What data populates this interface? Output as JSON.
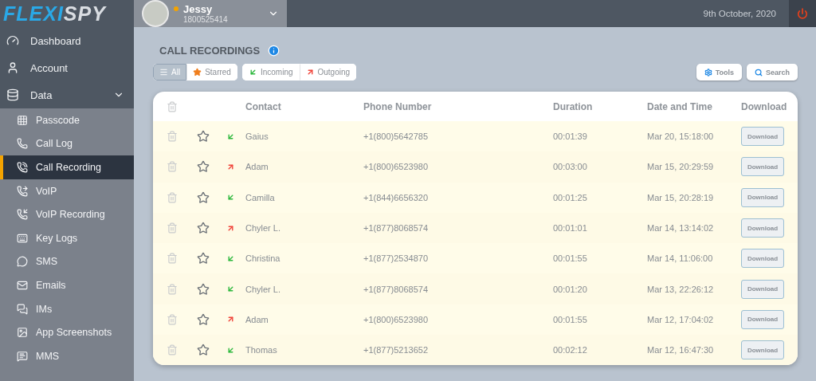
{
  "logo": {
    "part_1": "FLEXI",
    "part_2": "SPY"
  },
  "user": {
    "name": "Jessy",
    "phone": "1800525414"
  },
  "header": {
    "date": "9th October, 2020"
  },
  "sidebar": {
    "items": [
      {
        "label": "Dashboard",
        "selected": false
      },
      {
        "label": "Account",
        "selected": false
      },
      {
        "label": "Data",
        "selected": false,
        "expanded": true,
        "children": [
          {
            "label": "Passcode",
            "selected": false
          },
          {
            "label": "Call Log",
            "selected": false
          },
          {
            "label": "Call Recording",
            "selected": true
          },
          {
            "label": "VoIP",
            "selected": false
          },
          {
            "label": "VoIP Recording",
            "selected": false
          },
          {
            "label": "Key Logs",
            "selected": false
          },
          {
            "label": "SMS",
            "selected": false
          },
          {
            "label": "Emails",
            "selected": false
          },
          {
            "label": "IMs",
            "selected": false
          },
          {
            "label": "App Screenshots",
            "selected": false
          },
          {
            "label": "MMS",
            "selected": false
          }
        ]
      }
    ]
  },
  "page": {
    "title": "CALL RECORDINGS"
  },
  "filters": [
    [
      {
        "label": "All",
        "kind": "all",
        "selected": true
      },
      {
        "label": "Starred",
        "kind": "starred",
        "selected": false
      }
    ],
    [
      {
        "label": "Incoming",
        "kind": "incoming",
        "selected": false
      },
      {
        "label": "Outgoing",
        "kind": "outgoing",
        "selected": false
      }
    ]
  ],
  "actions": [
    {
      "label": "Tools",
      "kind": "tools"
    },
    {
      "label": "Search",
      "kind": "search"
    }
  ],
  "table": {
    "columns": [
      "Contact",
      "Phone Number",
      "Duration",
      "Date and Time",
      "Download"
    ],
    "rows": [
      {
        "starred": false,
        "incoming": true,
        "contact": "Gaius",
        "phone": "+1(800)5642785",
        "duration": "00:01:39",
        "datetime": "Mar 20, 15:18:00",
        "download": "Download"
      },
      {
        "starred": false,
        "incoming": false,
        "contact": "Adam",
        "phone": "+1(800)6523980",
        "duration": "00:03:00",
        "datetime": "Mar 15, 20:29:59",
        "download": "Download"
      },
      {
        "starred": false,
        "incoming": true,
        "contact": "Camilla",
        "phone": "+1(844)6656320",
        "duration": "00:01:25",
        "datetime": "Mar 15, 20:28:19",
        "download": "Download"
      },
      {
        "starred": false,
        "incoming": false,
        "contact": "Chyler L.",
        "phone": "+1(877)8068574",
        "duration": "00:01:01",
        "datetime": "Mar 14, 13:14:02",
        "download": "Download"
      },
      {
        "starred": false,
        "incoming": true,
        "contact": "Christina",
        "phone": "+1(877)2534870",
        "duration": "00:01:55",
        "datetime": "Mar 14, 11:06:00",
        "download": "Download"
      },
      {
        "starred": false,
        "incoming": true,
        "contact": "Chyler L.",
        "phone": "+1(877)8068574",
        "duration": "00:01:20",
        "datetime": "Mar 13, 22:26:12",
        "download": "Download"
      },
      {
        "starred": false,
        "incoming": false,
        "contact": "Adam",
        "phone": "+1(800)6523980",
        "duration": "00:01:55",
        "datetime": "Mar 12, 17:04:02",
        "download": "Download"
      },
      {
        "starred": false,
        "incoming": true,
        "contact": "Thomas",
        "phone": "+1(877)5213652",
        "duration": "00:02:12",
        "datetime": "Mar 12, 16:47:30",
        "download": "Download"
      }
    ]
  }
}
